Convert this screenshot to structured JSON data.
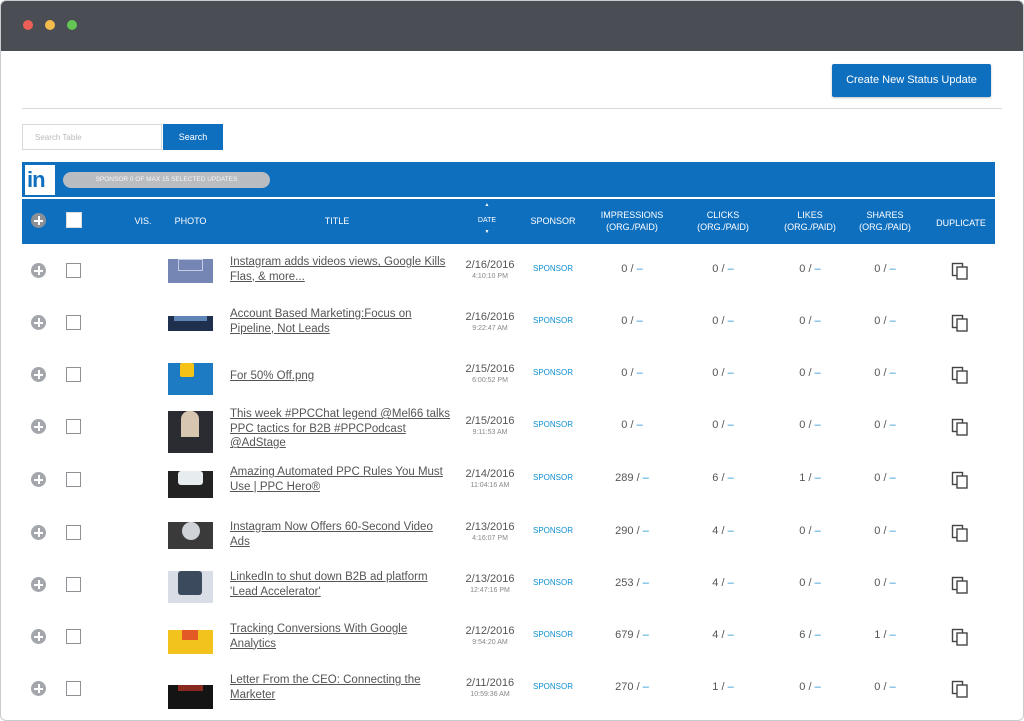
{
  "toolbar": {
    "create_label": "Create New Status Update"
  },
  "search": {
    "placeholder": "Search Table",
    "button_label": "Search"
  },
  "banner": {
    "logo": "in",
    "sponsor_text": "SPONSOR 0 OF MAX 15 SELECTED UPDATES"
  },
  "columns": {
    "vis": "VIS.",
    "photo": "PHOTO",
    "title": "TITLE",
    "date": "DATE",
    "sponsor": "SPONSOR",
    "impressions": "IMPRESSIONS",
    "clicks": "CLICKS",
    "likes": "LIKES",
    "shares": "SHARES",
    "sub": "(ORG./PAID)",
    "duplicate": "DUPLICATE"
  },
  "colors": {
    "accent": "#0f6fbf",
    "paid": "#1b8fd1",
    "titlebar": "#4a4d54"
  },
  "icons": {
    "expand": "plus-circle-icon",
    "duplicate": "copy-icon",
    "sort": "sort-arrows-icon"
  },
  "rows": [
    {
      "title": "Instagram adds videos views, Google Kills Flas, & more...",
      "date": "2/16/2016",
      "time": "4:10:10 PM",
      "sponsor": "SPONSOR",
      "impressions": "0 / ",
      "impressions_paid": "–",
      "clicks": "0 / ",
      "clicks_paid": "–",
      "likes": "0 / ",
      "likes_paid": "–",
      "shares": "0 / ",
      "shares_paid": "–"
    },
    {
      "title": "Account  Based Marketing:Focus on Pipeline, Not Leads",
      "date": "2/16/2016",
      "time": "9:22:47 AM",
      "sponsor": "SPONSOR",
      "impressions": "0 / ",
      "impressions_paid": "–",
      "clicks": "0 / ",
      "clicks_paid": "–",
      "likes": "0 / ",
      "likes_paid": "–",
      "shares": "0 / ",
      "shares_paid": "–"
    },
    {
      "title": "For 50% Off.png",
      "date": "2/15/2016",
      "time": "6:00:52 PM",
      "sponsor": "SPONSOR",
      "impressions": "0 / ",
      "impressions_paid": "–",
      "clicks": "0 / ",
      "clicks_paid": "–",
      "likes": "0 / ",
      "likes_paid": "–",
      "shares": "0 / ",
      "shares_paid": "–"
    },
    {
      "title": "This week #PPCChat legend @Mel66 talks PPC tactics for B2B #PPCPodcast @AdStage",
      "date": "2/15/2016",
      "time": "9:11:53 AM",
      "sponsor": "SPONSOR",
      "impressions": "0 / ",
      "impressions_paid": "–",
      "clicks": "0 / ",
      "clicks_paid": "–",
      "likes": "0 / ",
      "likes_paid": "–",
      "shares": "0 / ",
      "shares_paid": "–"
    },
    {
      "title": "Amazing Automated PPC Rules You Must Use | PPC Hero®",
      "date": "2/14/2016",
      "time": "11:04:16 AM",
      "sponsor": "SPONSOR",
      "impressions": "289 / ",
      "impressions_paid": "–",
      "clicks": "6 / ",
      "clicks_paid": "–",
      "likes": "1 / ",
      "likes_paid": "–",
      "shares": "0 / ",
      "shares_paid": "–"
    },
    {
      "title": "Instagram Now Offers 60-Second Video Ads",
      "date": "2/13/2016",
      "time": "4:16:07 PM",
      "sponsor": "SPONSOR",
      "impressions": "290 / ",
      "impressions_paid": "–",
      "clicks": "4 / ",
      "clicks_paid": "–",
      "likes": "0 / ",
      "likes_paid": "–",
      "shares": "0 / ",
      "shares_paid": "–"
    },
    {
      "title": "LinkedIn to shut down B2B ad platform 'Lead Accelerator'",
      "date": "2/13/2016",
      "time": "12:47:16 PM",
      "sponsor": "SPONSOR",
      "impressions": "253 / ",
      "impressions_paid": "–",
      "clicks": "4 / ",
      "clicks_paid": "–",
      "likes": "0 / ",
      "likes_paid": "–",
      "shares": "0 / ",
      "shares_paid": "–"
    },
    {
      "title": "Tracking Conversions With Google Analytics",
      "date": "2/12/2016",
      "time": "9:54:20 AM",
      "sponsor": "SPONSOR",
      "impressions": "679 / ",
      "impressions_paid": "–",
      "clicks": "4 / ",
      "clicks_paid": "–",
      "likes": "6 / ",
      "likes_paid": "–",
      "shares": "1 / ",
      "shares_paid": "–"
    },
    {
      "title": "Letter From the CEO: Connecting the Marketer",
      "date": "2/11/2016",
      "time": "10:59:36 AM",
      "sponsor": "SPONSOR",
      "impressions": "270 / ",
      "impressions_paid": "–",
      "clicks": "1 / ",
      "clicks_paid": "–",
      "likes": "0 / ",
      "likes_paid": "–",
      "shares": "0 / ",
      "shares_paid": "–"
    }
  ]
}
